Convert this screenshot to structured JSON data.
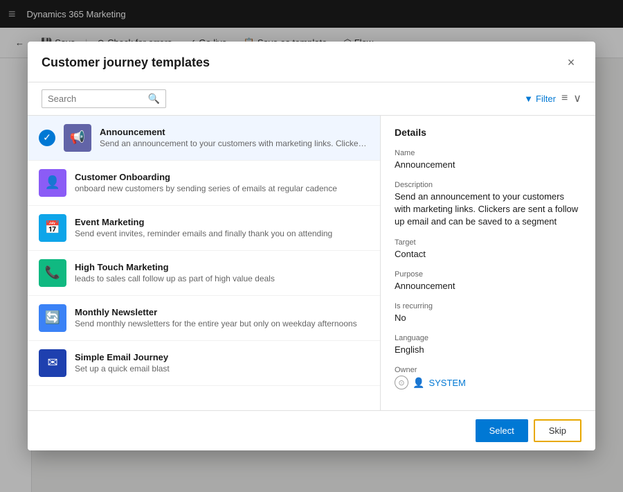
{
  "modal": {
    "title": "Customer journey templates",
    "close_label": "×"
  },
  "search": {
    "placeholder": "Search",
    "icon": "🔍"
  },
  "filter": {
    "label": "Filter"
  },
  "templates": [
    {
      "id": "announcement",
      "name": "Announcement",
      "desc": "Send an announcement to your customers with marketing links. Clickers are sent a...",
      "icon_class": "announcement",
      "icon_symbol": "📢",
      "selected": true
    },
    {
      "id": "onboarding",
      "name": "Customer Onboarding",
      "desc": "onboard new customers by sending series of emails at regular cadence",
      "icon_class": "onboarding",
      "icon_symbol": "👤",
      "selected": false
    },
    {
      "id": "event",
      "name": "Event Marketing",
      "desc": "Send event invites, reminder emails and finally thank you on attending",
      "icon_class": "event",
      "icon_symbol": "📅",
      "selected": false
    },
    {
      "id": "hightouch",
      "name": "High Touch Marketing",
      "desc": "leads to sales call follow up as part of high value deals",
      "icon_class": "hightouch",
      "icon_symbol": "📞",
      "selected": false
    },
    {
      "id": "newsletter",
      "name": "Monthly Newsletter",
      "desc": "Send monthly newsletters for the entire year but only on weekday afternoons",
      "icon_class": "newsletter",
      "icon_symbol": "🔄",
      "selected": false
    },
    {
      "id": "simple",
      "name": "Simple Email Journey",
      "desc": "Set up a quick email blast",
      "icon_class": "simple",
      "icon_symbol": "✉",
      "selected": false
    }
  ],
  "details": {
    "heading": "Details",
    "name_label": "Name",
    "name_value": "Announcement",
    "description_label": "Description",
    "description_value": "Send an announcement to your customers with marketing links. Clickers are sent a follow up email and can be saved to a segment",
    "target_label": "Target",
    "target_value": "Contact",
    "purpose_label": "Purpose",
    "purpose_value": "Announcement",
    "recurring_label": "Is recurring",
    "recurring_value": "No",
    "language_label": "Language",
    "language_value": "English",
    "owner_label": "Owner",
    "owner_value": "SYSTEM"
  },
  "footer": {
    "select_label": "Select",
    "skip_label": "Skip"
  },
  "toolbar": {
    "back_label": "←",
    "save_label": "Save",
    "check_errors_label": "Check for errors",
    "go_live_label": "Go live",
    "save_template_label": "Save as template",
    "flow_label": "Flow"
  }
}
